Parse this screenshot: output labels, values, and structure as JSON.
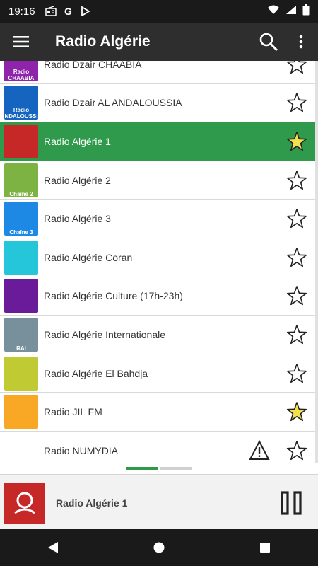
{
  "status": {
    "time": "19:16"
  },
  "app": {
    "title": "Radio Algérie"
  },
  "stations": [
    {
      "name": "Radio Dzair CHAABIA",
      "thumb_text": "Radio CHAABIA",
      "thumb_color": "#8e24aa",
      "favorite": false,
      "warning": false,
      "selected": false
    },
    {
      "name": "Radio Dzair AL ANDALOUSSIA",
      "thumb_text": "Radio ANDALOUSSIA",
      "thumb_color": "#1565c0",
      "favorite": false,
      "warning": false,
      "selected": false
    },
    {
      "name": "Radio Algérie 1",
      "thumb_text": "",
      "thumb_color": "#c62828",
      "favorite": true,
      "warning": false,
      "selected": true
    },
    {
      "name": "Radio Algérie 2",
      "thumb_text": "Chaîne 2",
      "thumb_color": "#7cb342",
      "favorite": false,
      "warning": false,
      "selected": false
    },
    {
      "name": "Radio Algérie 3",
      "thumb_text": "Chaîne 3",
      "thumb_color": "#1e88e5",
      "favorite": false,
      "warning": false,
      "selected": false
    },
    {
      "name": "Radio Algérie Coran",
      "thumb_text": "",
      "thumb_color": "#26c6da",
      "favorite": false,
      "warning": false,
      "selected": false
    },
    {
      "name": "Radio Algérie Culture (17h-23h)",
      "thumb_text": "",
      "thumb_color": "#6a1b9a",
      "favorite": false,
      "warning": false,
      "selected": false
    },
    {
      "name": "Radio Algérie Internationale",
      "thumb_text": "RAI",
      "thumb_color": "#78909c",
      "favorite": false,
      "warning": false,
      "selected": false
    },
    {
      "name": "Radio Algérie El Bahdja",
      "thumb_text": "",
      "thumb_color": "#c0ca33",
      "favorite": false,
      "warning": false,
      "selected": false
    },
    {
      "name": "Radio JIL FM",
      "thumb_text": "",
      "thumb_color": "#f9a825",
      "favorite": true,
      "warning": false,
      "selected": false
    },
    {
      "name": "Radio NUMYDIA",
      "thumb_text": "",
      "thumb_color": "#ffffff",
      "favorite": false,
      "warning": true,
      "selected": false
    }
  ],
  "player": {
    "title": "Radio Algérie 1"
  },
  "colors": {
    "accent": "#2f9a4b",
    "star_fill": "#f4e04d",
    "appbar": "#2e2e2e"
  }
}
